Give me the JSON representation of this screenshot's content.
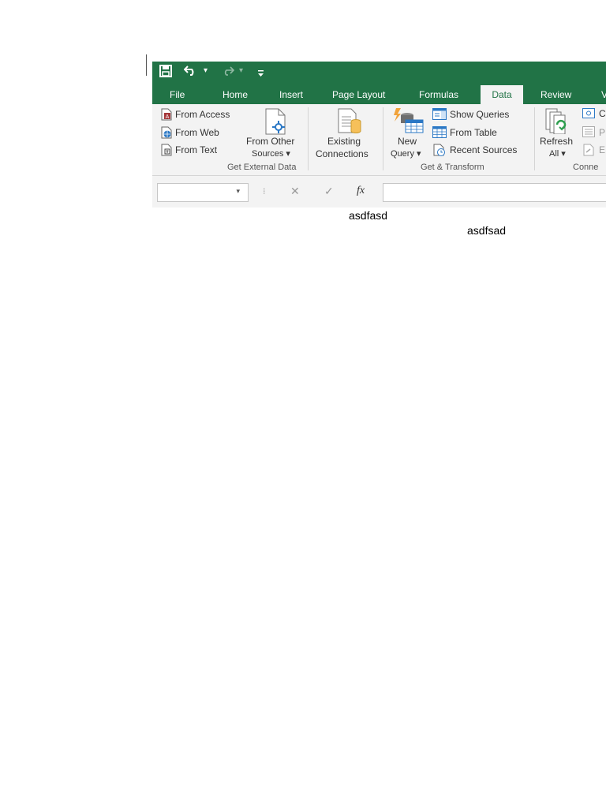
{
  "quick_access": {
    "save_icon": "save-icon",
    "undo_icon": "undo-icon",
    "undo_dropdown": "▾",
    "redo_icon": "redo-icon",
    "redo_dropdown": "▾",
    "customize_icon": "customize-qat-icon"
  },
  "tabs": [
    {
      "label": "File"
    },
    {
      "label": "Home"
    },
    {
      "label": "Insert"
    },
    {
      "label": "Page Layout"
    },
    {
      "label": "Formulas"
    },
    {
      "label": "Data",
      "active": true
    },
    {
      "label": "Review"
    },
    {
      "label": "V"
    }
  ],
  "ribbon": {
    "get_external_data": {
      "from_access": "From Access",
      "from_web": "From Web",
      "from_text": "From Text",
      "from_other_sources_1": "From Other",
      "from_other_sources_2": "Sources ▾",
      "existing_connections_1": "Existing",
      "existing_connections_2": "Connections",
      "group_label": "Get External Data"
    },
    "get_transform": {
      "new_query_1": "New",
      "new_query_2": "Query ▾",
      "show_queries": "Show Queries",
      "from_table": "From Table",
      "recent_sources": "Recent Sources",
      "group_label": "Get & Transform"
    },
    "connections": {
      "refresh_all_1": "Refresh",
      "refresh_all_2": "All ▾",
      "connections_partial": "C",
      "properties_partial": "P",
      "edit_links_partial": "E",
      "group_label": "Conne"
    }
  },
  "formula_bar": {
    "name_box_value": "",
    "name_box_arrow": "▾",
    "cancel_symbol": "✕",
    "enter_symbol": "✓",
    "fx_symbol": "fx",
    "formula_value": ""
  },
  "notes": {
    "text1": "asdfasd",
    "text2": "asdfsad"
  },
  "colors": {
    "accent": "#217346",
    "ribbon_bg": "#f3f3f3"
  }
}
